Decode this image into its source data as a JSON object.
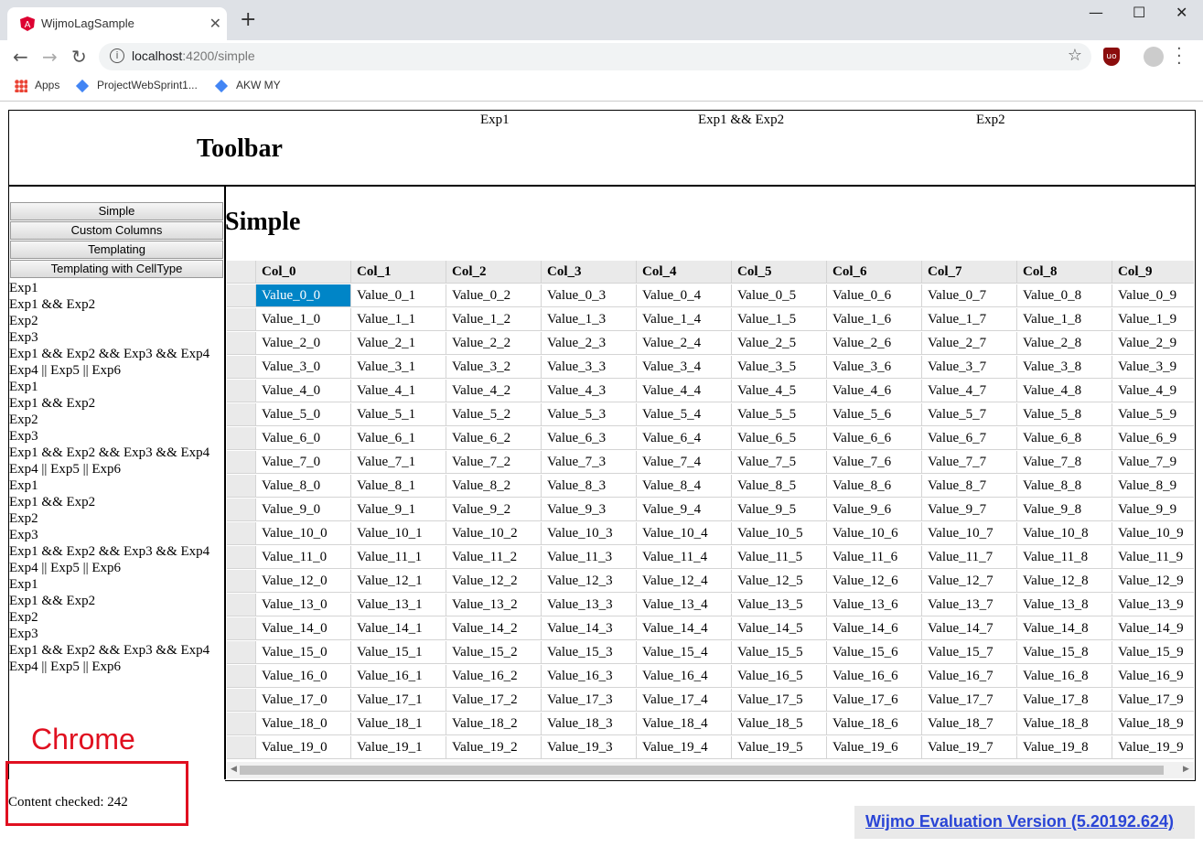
{
  "browser": {
    "tab_title": "WijmoLagSample",
    "url_host": "localhost",
    "url_rest": ":4200/simple",
    "bookmarks": [
      "Apps",
      "ProjectWebSprint1...",
      "AKW MY"
    ]
  },
  "toolbar": {
    "title": "Toolbar",
    "links": [
      "Exp1",
      "Exp1 && Exp2",
      "Exp2"
    ]
  },
  "sidebar": {
    "buttons": [
      "Simple",
      "Custom Columns",
      "Templating",
      "Templating with CellType"
    ],
    "items": [
      "Exp1",
      "Exp1 && Exp2",
      "Exp2",
      "Exp3",
      "Exp1 && Exp2 && Exp3 && Exp4",
      "Exp4 || Exp5 || Exp6",
      "Exp1",
      "Exp1 && Exp2",
      "Exp2",
      "Exp3",
      "Exp1 && Exp2 && Exp3 && Exp4",
      "Exp4 || Exp5 || Exp6",
      "Exp1",
      "Exp1 && Exp2",
      "Exp2",
      "Exp3",
      "Exp1 && Exp2 && Exp3 && Exp4",
      "Exp4 || Exp5 || Exp6",
      "Exp1",
      "Exp1 && Exp2",
      "Exp2",
      "Exp3",
      "Exp1 && Exp2 && Exp3 && Exp4",
      "Exp4 || Exp5 || Exp6"
    ]
  },
  "main": {
    "title": "Simple",
    "grid": {
      "columns": [
        "Col_0",
        "Col_1",
        "Col_2",
        "Col_3",
        "Col_4",
        "Col_5",
        "Col_6",
        "Col_7",
        "Col_8",
        "Col_9"
      ],
      "rows": [
        [
          "Value_0_0",
          "Value_0_1",
          "Value_0_2",
          "Value_0_3",
          "Value_0_4",
          "Value_0_5",
          "Value_0_6",
          "Value_0_7",
          "Value_0_8",
          "Value_0_9"
        ],
        [
          "Value_1_0",
          "Value_1_1",
          "Value_1_2",
          "Value_1_3",
          "Value_1_4",
          "Value_1_5",
          "Value_1_6",
          "Value_1_7",
          "Value_1_8",
          "Value_1_9"
        ],
        [
          "Value_2_0",
          "Value_2_1",
          "Value_2_2",
          "Value_2_3",
          "Value_2_4",
          "Value_2_5",
          "Value_2_6",
          "Value_2_7",
          "Value_2_8",
          "Value_2_9"
        ],
        [
          "Value_3_0",
          "Value_3_1",
          "Value_3_2",
          "Value_3_3",
          "Value_3_4",
          "Value_3_5",
          "Value_3_6",
          "Value_3_7",
          "Value_3_8",
          "Value_3_9"
        ],
        [
          "Value_4_0",
          "Value_4_1",
          "Value_4_2",
          "Value_4_3",
          "Value_4_4",
          "Value_4_5",
          "Value_4_6",
          "Value_4_7",
          "Value_4_8",
          "Value_4_9"
        ],
        [
          "Value_5_0",
          "Value_5_1",
          "Value_5_2",
          "Value_5_3",
          "Value_5_4",
          "Value_5_5",
          "Value_5_6",
          "Value_5_7",
          "Value_5_8",
          "Value_5_9"
        ],
        [
          "Value_6_0",
          "Value_6_1",
          "Value_6_2",
          "Value_6_3",
          "Value_6_4",
          "Value_6_5",
          "Value_6_6",
          "Value_6_7",
          "Value_6_8",
          "Value_6_9"
        ],
        [
          "Value_7_0",
          "Value_7_1",
          "Value_7_2",
          "Value_7_3",
          "Value_7_4",
          "Value_7_5",
          "Value_7_6",
          "Value_7_7",
          "Value_7_8",
          "Value_7_9"
        ],
        [
          "Value_8_0",
          "Value_8_1",
          "Value_8_2",
          "Value_8_3",
          "Value_8_4",
          "Value_8_5",
          "Value_8_6",
          "Value_8_7",
          "Value_8_8",
          "Value_8_9"
        ],
        [
          "Value_9_0",
          "Value_9_1",
          "Value_9_2",
          "Value_9_3",
          "Value_9_4",
          "Value_9_5",
          "Value_9_6",
          "Value_9_7",
          "Value_9_8",
          "Value_9_9"
        ],
        [
          "Value_10_0",
          "Value_10_1",
          "Value_10_2",
          "Value_10_3",
          "Value_10_4",
          "Value_10_5",
          "Value_10_6",
          "Value_10_7",
          "Value_10_8",
          "Value_10_9"
        ],
        [
          "Value_11_0",
          "Value_11_1",
          "Value_11_2",
          "Value_11_3",
          "Value_11_4",
          "Value_11_5",
          "Value_11_6",
          "Value_11_7",
          "Value_11_8",
          "Value_11_9"
        ],
        [
          "Value_12_0",
          "Value_12_1",
          "Value_12_2",
          "Value_12_3",
          "Value_12_4",
          "Value_12_5",
          "Value_12_6",
          "Value_12_7",
          "Value_12_8",
          "Value_12_9"
        ],
        [
          "Value_13_0",
          "Value_13_1",
          "Value_13_2",
          "Value_13_3",
          "Value_13_4",
          "Value_13_5",
          "Value_13_6",
          "Value_13_7",
          "Value_13_8",
          "Value_13_9"
        ],
        [
          "Value_14_0",
          "Value_14_1",
          "Value_14_2",
          "Value_14_3",
          "Value_14_4",
          "Value_14_5",
          "Value_14_6",
          "Value_14_7",
          "Value_14_8",
          "Value_14_9"
        ],
        [
          "Value_15_0",
          "Value_15_1",
          "Value_15_2",
          "Value_15_3",
          "Value_15_4",
          "Value_15_5",
          "Value_15_6",
          "Value_15_7",
          "Value_15_8",
          "Value_15_9"
        ],
        [
          "Value_16_0",
          "Value_16_1",
          "Value_16_2",
          "Value_16_3",
          "Value_16_4",
          "Value_16_5",
          "Value_16_6",
          "Value_16_7",
          "Value_16_8",
          "Value_16_9"
        ],
        [
          "Value_17_0",
          "Value_17_1",
          "Value_17_2",
          "Value_17_3",
          "Value_17_4",
          "Value_17_5",
          "Value_17_6",
          "Value_17_7",
          "Value_17_8",
          "Value_17_9"
        ],
        [
          "Value_18_0",
          "Value_18_1",
          "Value_18_2",
          "Value_18_3",
          "Value_18_4",
          "Value_18_5",
          "Value_18_6",
          "Value_18_7",
          "Value_18_8",
          "Value_18_9"
        ],
        [
          "Value_19_0",
          "Value_19_1",
          "Value_19_2",
          "Value_19_3",
          "Value_19_4",
          "Value_19_5",
          "Value_19_6",
          "Value_19_7",
          "Value_19_8",
          "Value_19_9"
        ]
      ],
      "selected_cell": "Value_0_0",
      "selection_color": "#0085c7"
    }
  },
  "status": {
    "content_checked": "Content checked: 242"
  },
  "annotation": {
    "label": "Chrome",
    "color": "#e01020"
  },
  "eval_banner": "Wijmo Evaluation Version (5.20192.624)"
}
